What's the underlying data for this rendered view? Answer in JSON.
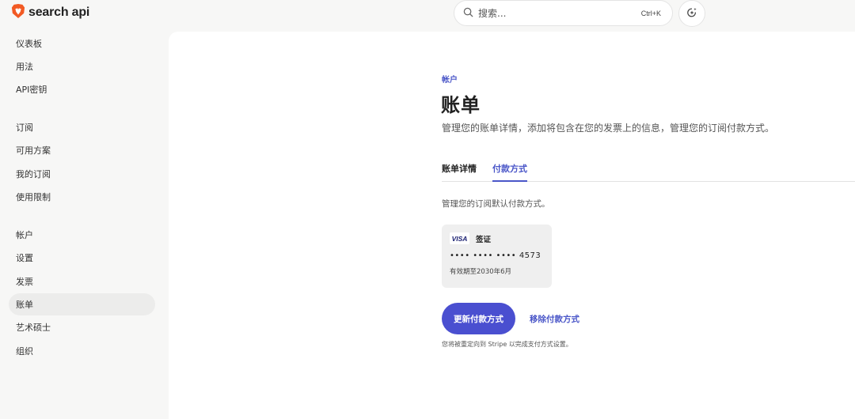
{
  "app": {
    "brand": "search api"
  },
  "search": {
    "placeholder": "搜索...",
    "shortcut": "Ctrl+K"
  },
  "sidebar": {
    "items": [
      {
        "label": "仪表板"
      },
      {
        "label": "用法"
      },
      {
        "label": "API密钥"
      },
      {
        "label": "订阅"
      },
      {
        "label": "可用方案"
      },
      {
        "label": "我的订阅"
      },
      {
        "label": "使用限制"
      },
      {
        "label": "帐户"
      },
      {
        "label": "设置"
      },
      {
        "label": "发票"
      },
      {
        "label": "账单",
        "active": true
      },
      {
        "label": "艺术硕士"
      },
      {
        "label": "组织"
      }
    ]
  },
  "main": {
    "section": "帐户",
    "title": "账单",
    "description": "管理您的账单详情，添加将包含在您的发票上的信息，管理您的订阅付款方式。",
    "tabs": [
      {
        "label": "账单详情"
      },
      {
        "label": "付款方式",
        "active": true
      }
    ],
    "payment": {
      "description": "管理您的订阅默认付款方式。",
      "card": {
        "network_logo": "VISA",
        "brand": "签证",
        "number": "•••• •••• •••• 4573",
        "expiry": "有效期至2030年6月"
      },
      "update_button": "更新付款方式",
      "remove_button": "移除付款方式",
      "note": "您将被重定向到 Stripe 以完成支付方式设置。"
    }
  },
  "colors": {
    "accent": "#4a4fd0",
    "link": "#4a56c8",
    "brand_lion": "#f25a24"
  },
  "icons": {
    "logo": "brave-lion-icon",
    "search": "search-icon",
    "ai": "ai-sparkle-icon"
  }
}
